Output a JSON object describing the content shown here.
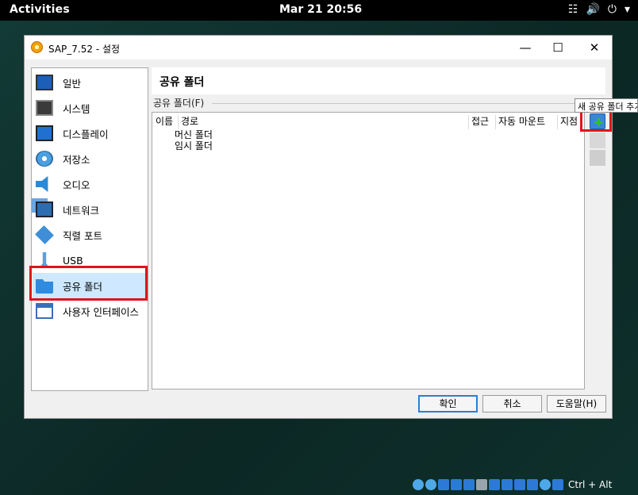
{
  "topbar": {
    "activities": "Activities",
    "clock": "Mar 21  20:56",
    "tray_icons": [
      "network-icon",
      "volume-icon",
      "power-icon",
      "dropdown-arrow-icon"
    ]
  },
  "window": {
    "title": "SAP_7.52 - 설정",
    "minimize": "—",
    "maximize": "☐",
    "close": "✕"
  },
  "sidebar": {
    "items": [
      {
        "label": "일반",
        "icon": "monitor-icon"
      },
      {
        "label": "시스템",
        "icon": "chip-icon"
      },
      {
        "label": "디스플레이",
        "icon": "display-icon"
      },
      {
        "label": "저장소",
        "icon": "disk-icon"
      },
      {
        "label": "오디오",
        "icon": "speaker-icon"
      },
      {
        "label": "네트워크",
        "icon": "network-icon"
      },
      {
        "label": "직렬 포트",
        "icon": "serial-port-icon"
      },
      {
        "label": "USB",
        "icon": "usb-icon"
      },
      {
        "label": "공유 폴더",
        "icon": "folder-icon",
        "selected": true
      },
      {
        "label": "사용자 인터페이스",
        "icon": "user-interface-icon"
      }
    ]
  },
  "content": {
    "title": "공유 폴더",
    "group_label": "공유 폴더(F)",
    "columns": [
      "이름",
      "경로",
      "접근",
      "자동 마운트",
      "지점"
    ],
    "rows": [
      "머신 폴더",
      "임시 폴더"
    ],
    "tooltip": "새 공유 폴더 추가"
  },
  "buttons": {
    "ok": "확인",
    "cancel": "취소",
    "help": "도움말(H)"
  },
  "statusbar": {
    "host_key": "Ctrl + Alt"
  },
  "colors": {
    "highlight": "#e0141c",
    "selection": "#cde8ff",
    "accent": "#2a7fd4"
  }
}
